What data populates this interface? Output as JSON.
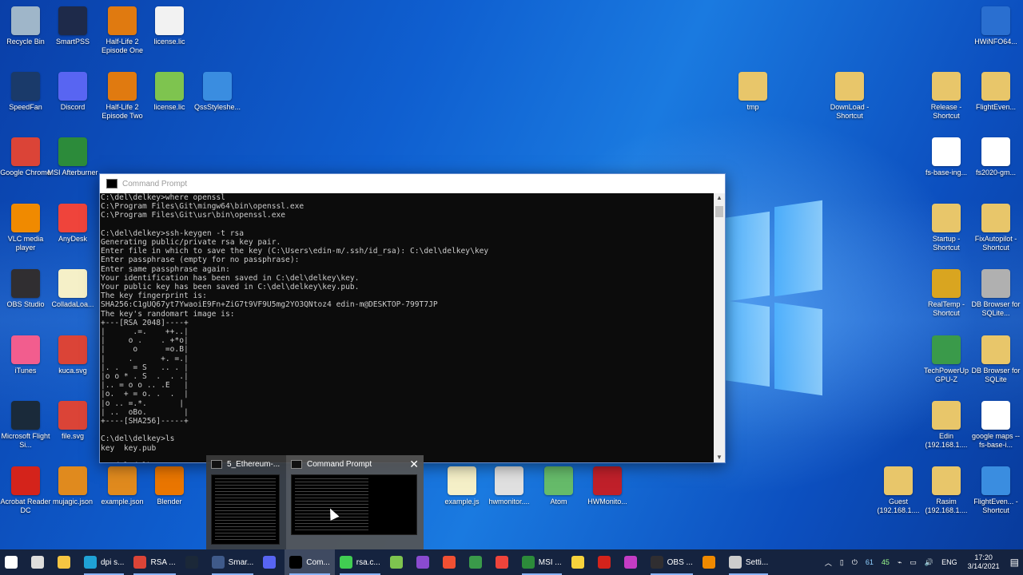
{
  "colors": {
    "desktop": "#0f5fd0",
    "taskbar": "#15233f",
    "console_bg": "#0c0c0c",
    "console_fg": "#cccccc"
  },
  "desktop_icons": [
    {
      "label": "Recycle Bin",
      "icon": "recycle-bin-icon",
      "color": "#9fb6c9"
    },
    {
      "label": "SmartPSS",
      "icon": "smartpss-icon",
      "color": "#1e2a4a"
    },
    {
      "label": "Half-Life 2 Episode One",
      "icon": "half-life-icon",
      "color": "#e07a10"
    },
    {
      "label": "license.lic",
      "icon": "file-icon",
      "color": "#f2f2f2"
    },
    {
      "label": "HWiNFO64...",
      "icon": "hwinfo-icon",
      "color": "#2a6fd0"
    },
    {
      "label": "SpeedFan",
      "icon": "fan-icon",
      "color": "#1a3a6a"
    },
    {
      "label": "Discord",
      "icon": "discord-icon",
      "color": "#5865f2"
    },
    {
      "label": "Half-Life 2 Episode Two",
      "icon": "half-life-icon",
      "color": "#e07a10"
    },
    {
      "label": "license.lic",
      "icon": "cert-file-icon",
      "color": "#7ec44f"
    },
    {
      "label": "QssStyleshe...",
      "icon": "brush-icon",
      "color": "#3a8de0"
    },
    {
      "label": "tmp",
      "icon": "folder-icon",
      "color": "#e8c66a"
    },
    {
      "label": "DownLoad - Shortcut",
      "icon": "folder-shortcut-icon",
      "color": "#e8c66a"
    },
    {
      "label": "Release - Shortcut",
      "icon": "folder-shortcut-icon",
      "color": "#e8c66a"
    },
    {
      "label": "FlightEven...",
      "icon": "folder-icon",
      "color": "#e8c66a"
    },
    {
      "label": "Google Chrome",
      "icon": "chrome-icon",
      "color": "#db4437"
    },
    {
      "label": "MSI Afterburner",
      "icon": "msi-icon",
      "color": "#2c8b3a"
    },
    {
      "label": "fs-base-ing...",
      "icon": "7z-icon",
      "color": "#ffffff"
    },
    {
      "label": "fs2020-gm...",
      "icon": "7z-icon",
      "color": "#ffffff"
    },
    {
      "label": "VLC media player",
      "icon": "vlc-icon",
      "color": "#f08a00"
    },
    {
      "label": "AnyDesk",
      "icon": "anydesk-icon",
      "color": "#ef443b"
    },
    {
      "label": "Startup - Shortcut",
      "icon": "folder-shortcut-icon",
      "color": "#e8c66a"
    },
    {
      "label": "FixAutopilot - Shortcut",
      "icon": "folder-shortcut-icon",
      "color": "#e8c66a"
    },
    {
      "label": "OBS Studio",
      "icon": "obs-icon",
      "color": "#302e31"
    },
    {
      "label": "ColladaLoa...",
      "icon": "script-icon",
      "color": "#f5f0c8"
    },
    {
      "label": "RealTemp - Shortcut",
      "icon": "realtemp-icon",
      "color": "#d9a520"
    },
    {
      "label": "DB Browser for SQLite...",
      "icon": "database-icon",
      "color": "#b0b0b0"
    },
    {
      "label": "iTunes",
      "icon": "itunes-icon",
      "color": "#f25d8e"
    },
    {
      "label": "kuca.svg",
      "icon": "chrome-icon",
      "color": "#db4437"
    },
    {
      "label": "TechPowerUp GPU-Z",
      "icon": "gpuz-icon",
      "color": "#3a9a4a"
    },
    {
      "label": "DB Browser for SQLite",
      "icon": "folder-icon",
      "color": "#e8c66a"
    },
    {
      "label": "Microsoft Flight Si...",
      "icon": "flight-sim-icon",
      "color": "#1a2a3a"
    },
    {
      "label": "file.svg",
      "icon": "chrome-icon",
      "color": "#db4437"
    },
    {
      "label": "Edin (192.168.1....",
      "icon": "network-folder-icon",
      "color": "#e8c66a"
    },
    {
      "label": "google maps -- fs-base-i...",
      "icon": "7z-icon",
      "color": "#ffffff"
    },
    {
      "label": "Acrobat Reader DC",
      "icon": "acrobat-icon",
      "color": "#d4231b"
    },
    {
      "label": "mujagic.json",
      "icon": "sublime-icon",
      "color": "#e08a1e"
    },
    {
      "label": "example.json",
      "icon": "sublime-icon",
      "color": "#e08a1e"
    },
    {
      "label": "Blender",
      "icon": "blender-icon",
      "color": "#ea7600"
    },
    {
      "label": "example.js",
      "icon": "script-icon",
      "color": "#f5f0c8"
    },
    {
      "label": "hwmonitor....",
      "icon": "gear-file-icon",
      "color": "#e0e0e0"
    },
    {
      "label": "Atom",
      "icon": "atom-icon",
      "color": "#66bb6a"
    },
    {
      "label": "HWMonito...",
      "icon": "hwmonitor-icon",
      "color": "#c0202a"
    },
    {
      "label": "Guest (192.168.1....",
      "icon": "network-folder-icon",
      "color": "#e8c66a"
    },
    {
      "label": "Rasim (192.168.1....",
      "icon": "network-folder-icon",
      "color": "#e8c66a"
    },
    {
      "label": "FlightEven... - Shortcut",
      "icon": "flight-icon",
      "color": "#3a8de0"
    }
  ],
  "cmd_window": {
    "title": "Command Prompt",
    "lines": [
      "C:\\del\\delkey>where openssl",
      "C:\\Program Files\\Git\\mingw64\\bin\\openssl.exe",
      "C:\\Program Files\\Git\\usr\\bin\\openssl.exe",
      "",
      "C:\\del\\delkey>ssh-keygen -t rsa",
      "Generating public/private rsa key pair.",
      "Enter file in which to save the key (C:\\Users\\edin-m/.ssh/id_rsa): C:\\del\\delkey\\key",
      "Enter passphrase (empty for no passphrase):",
      "Enter same passphrase again:",
      "Your identification has been saved in C:\\del\\delkey\\key.",
      "Your public key has been saved in C:\\del\\delkey\\key.pub.",
      "The key fingerprint is:",
      "SHA256:C1gUQ67yt7YwaoiE9Fn+ZiG7t9VF9U5mg2YO3QNtoz4 edin-m@DESKTOP-799T7JP",
      "The key's randomart image is:",
      "+---[RSA 2048]----+",
      "|      .=.    ++..|",
      "|     o .    . +*o|",
      "|      o      =o.B|",
      "|     .      +. =.|",
      "|. .   = S   .. . |",
      "|o o * . S  .  . .|",
      "|.. = o o .. .E   |",
      "|o.  + = o. .  .  |",
      "|o .. =.*.       |",
      "| ..  oBo.        |",
      "+----[SHA256]-----+",
      "",
      "C:\\del\\delkey>ls",
      "key  key.pub",
      "",
      "C:\\del\\delkey>"
    ]
  },
  "preview": {
    "items": [
      {
        "title": "5_Ethereum-..."
      },
      {
        "title": "Command Prompt"
      }
    ],
    "close_glyph": "✕"
  },
  "taskbar": {
    "items": [
      {
        "label": "",
        "icon": "start-icon"
      },
      {
        "label": "",
        "icon": "task-view-icon"
      },
      {
        "label": "",
        "icon": "file-explorer-icon"
      },
      {
        "label": "dpi s...",
        "icon": "edge-icon"
      },
      {
        "label": "RSA ...",
        "icon": "chrome-icon"
      },
      {
        "label": "",
        "icon": "steam-icon"
      },
      {
        "label": "Smar...",
        "icon": "smartpss-icon"
      },
      {
        "label": "",
        "icon": "discord-icon"
      },
      {
        "label": "Com...",
        "icon": "cmd-icon"
      },
      {
        "label": "rsa.c...",
        "icon": "qt-creator-icon"
      },
      {
        "label": "",
        "icon": "notepad-icon"
      },
      {
        "label": "",
        "icon": "visual-studio-icon"
      },
      {
        "label": "",
        "icon": "git-icon"
      },
      {
        "label": "",
        "icon": "gpuz-icon"
      },
      {
        "label": "",
        "icon": "anydesk-icon"
      },
      {
        "label": "MSI ...",
        "icon": "msi-icon"
      },
      {
        "label": "",
        "icon": "sticky-icon"
      },
      {
        "label": "",
        "icon": "acrobat-icon"
      },
      {
        "label": "",
        "icon": "m-icon"
      },
      {
        "label": "OBS ...",
        "icon": "obs-icon"
      },
      {
        "label": "",
        "icon": "vlc-icon"
      },
      {
        "label": "Setti...",
        "icon": "settings-icon"
      }
    ],
    "tray": {
      "num1": "61",
      "num2": "45",
      "lang": "ENG",
      "time": "17:20",
      "date": "3/14/2021"
    }
  }
}
